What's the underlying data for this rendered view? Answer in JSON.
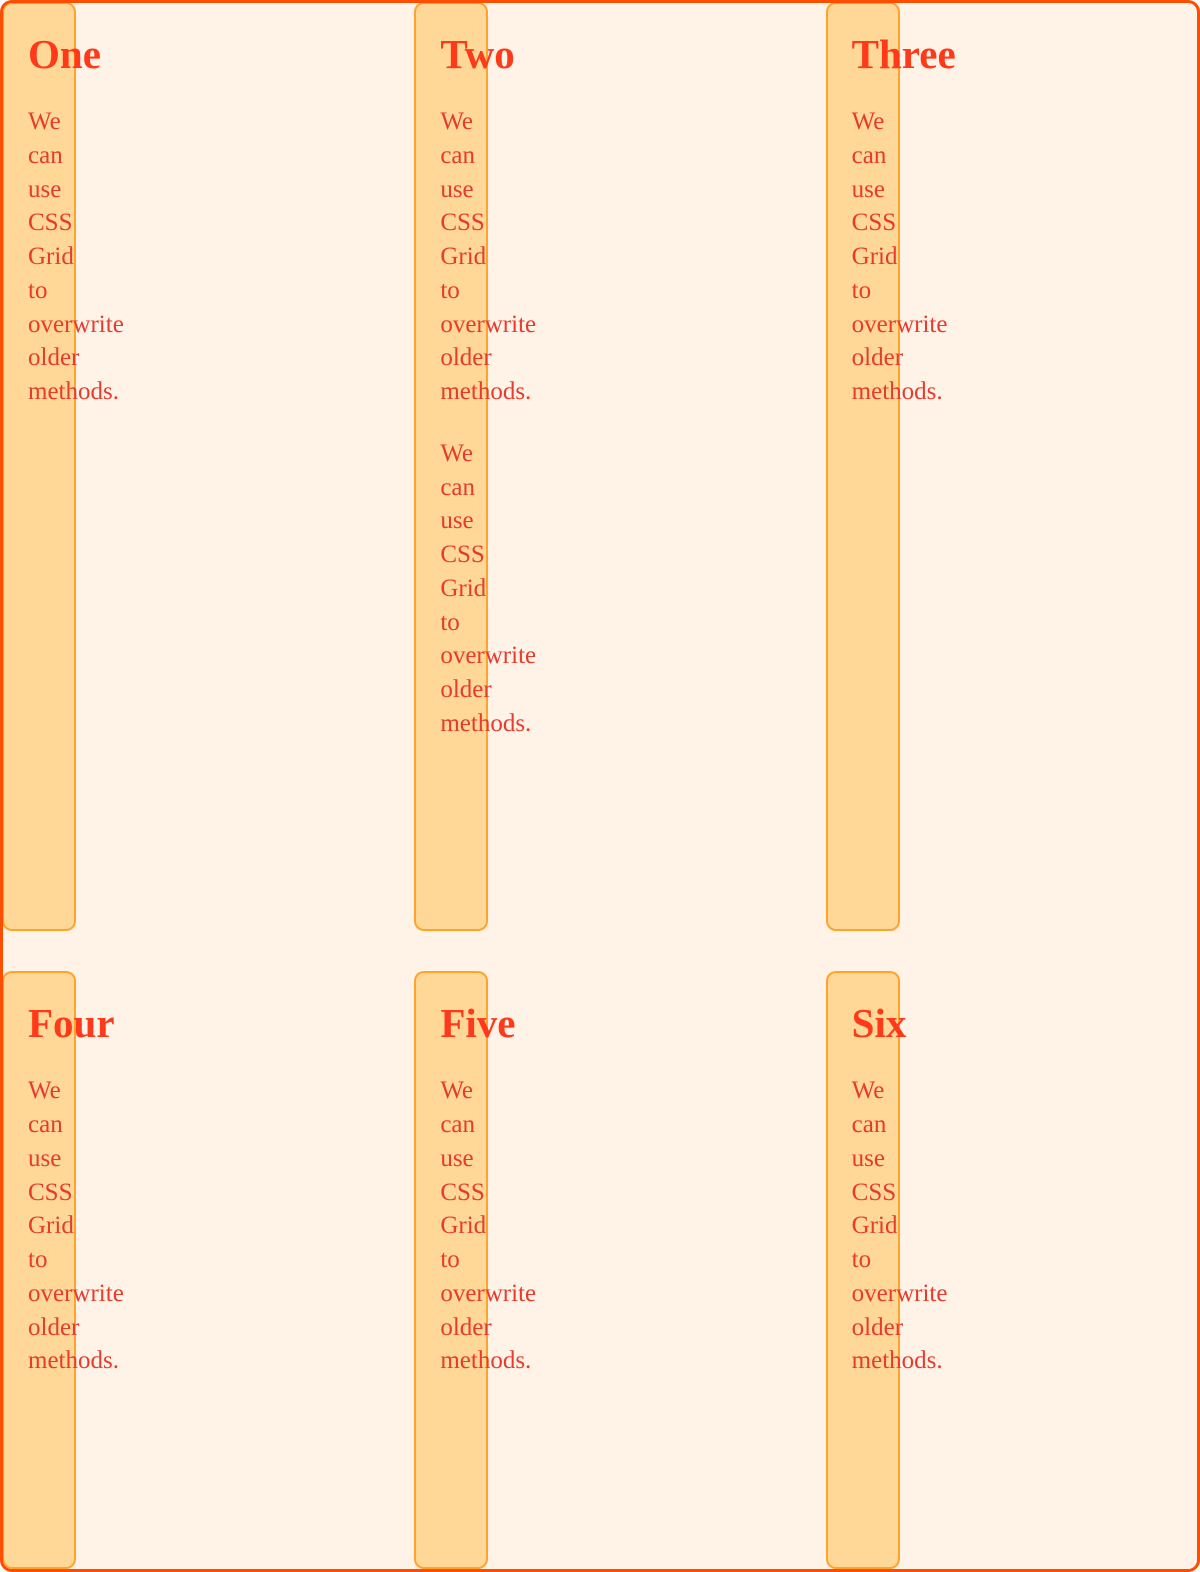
{
  "cards": [
    {
      "title": "One",
      "paragraphs": [
        "We can use CSS Grid to overwrite older methods."
      ]
    },
    {
      "title": "Two",
      "paragraphs": [
        "We can use CSS Grid to overwrite older methods.",
        "We can use CSS Grid to overwrite older methods."
      ]
    },
    {
      "title": "Three",
      "paragraphs": [
        "We can use CSS Grid to overwrite older methods."
      ]
    },
    {
      "title": "Four",
      "paragraphs": [
        "We can use CSS Grid to overwrite older methods."
      ]
    },
    {
      "title": "Five",
      "paragraphs": [
        "We can use CSS Grid to overwrite older methods."
      ]
    },
    {
      "title": "Six",
      "paragraphs": [
        "We can use CSS Grid to overwrite older methods."
      ]
    }
  ]
}
